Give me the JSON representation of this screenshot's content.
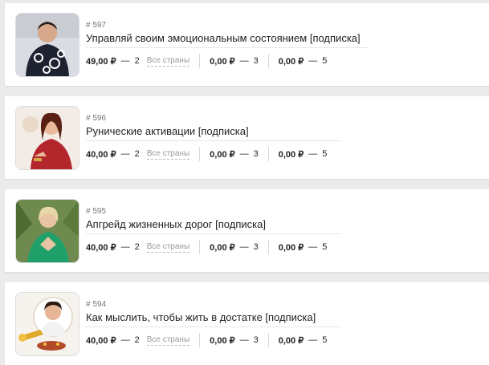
{
  "items": [
    {
      "id": "# 597",
      "title": "Управляй своим эмоциональным состоянием [подписка]",
      "price1": "49,00 ₽",
      "count1": "2",
      "countries": "Все страны",
      "price2": "0,00 ₽",
      "count2": "3",
      "price3": "0,00 ₽",
      "count3": "5"
    },
    {
      "id": "# 596",
      "title": "Рунические активации [подписка]",
      "price1": "40,00 ₽",
      "count1": "2",
      "countries": "Все страны",
      "price2": "0,00 ₽",
      "count2": "3",
      "price3": "0,00 ₽",
      "count3": "5"
    },
    {
      "id": "# 595",
      "title": "Апгрейд жизненных дорог [подписка]",
      "price1": "40,00 ₽",
      "count1": "2",
      "countries": "Все страны",
      "price2": "0,00 ₽",
      "count2": "3",
      "price3": "0,00 ₽",
      "count3": "5"
    },
    {
      "id": "# 594",
      "title": "Как мыслить, чтобы жить в достатке [подписка]",
      "price1": "40,00 ₽",
      "count1": "2",
      "countries": "Все страны",
      "price2": "0,00 ₽",
      "count2": "3",
      "price3": "0,00 ₽",
      "count3": "5"
    }
  ],
  "separator": "—"
}
